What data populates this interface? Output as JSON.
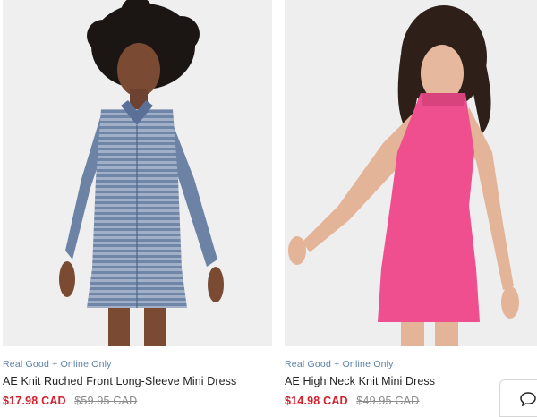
{
  "products": [
    {
      "badge": "Real Good + Online Only",
      "title": "AE Knit Ruched Front Long-Sleeve Mini Dress",
      "sale_price": "$17.98 CAD",
      "original_price": "$59.95 CAD",
      "dress_color": "#6f86a8"
    },
    {
      "badge": "Real Good + Online Only",
      "title": "AE High Neck Knit Mini Dress",
      "sale_price": "$14.98 CAD",
      "original_price": "$49.95 CAD",
      "dress_color": "#ef4f8e"
    }
  ],
  "colors": {
    "badge": "#5a7fa8",
    "sale": "#d51f2b",
    "original": "#8a8a8a"
  },
  "chat": {
    "icon": "chat-bubble-icon"
  }
}
